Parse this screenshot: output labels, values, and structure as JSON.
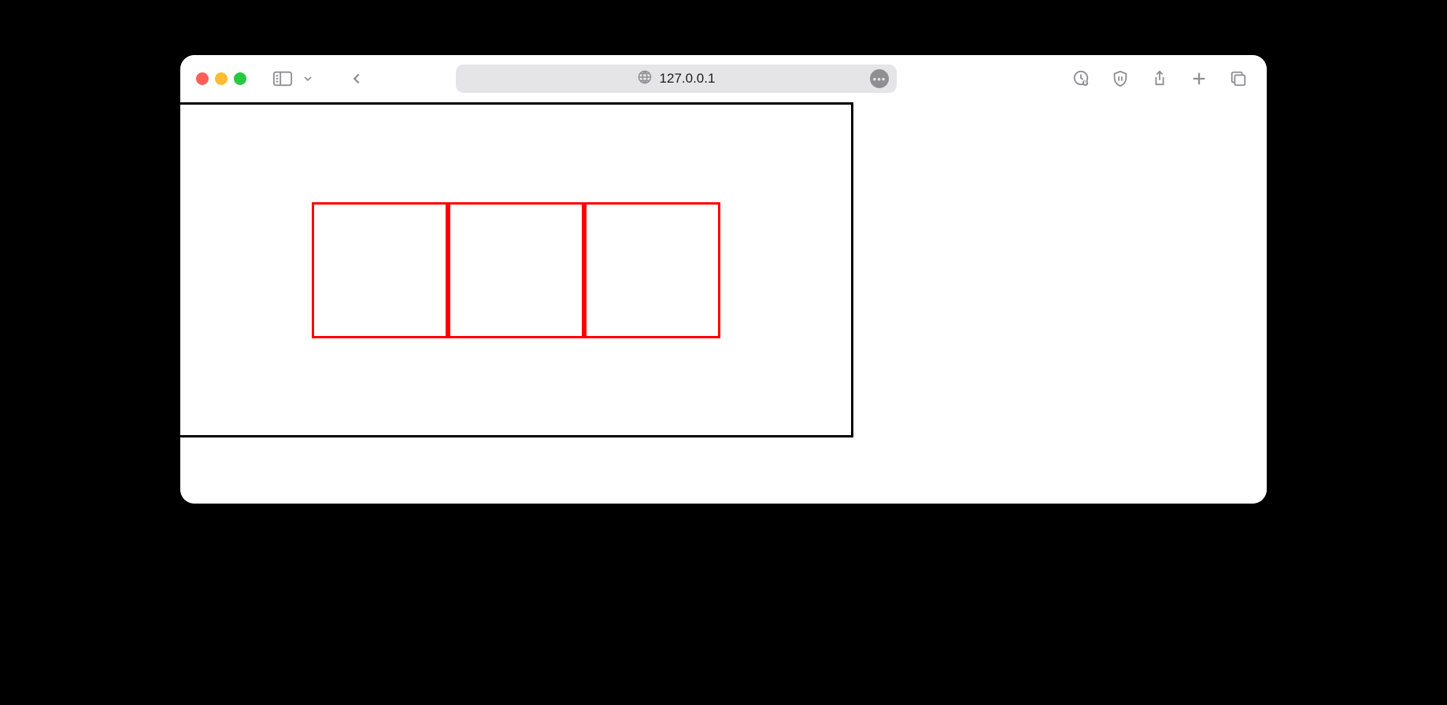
{
  "address_bar": {
    "url_display": "127.0.0.1"
  },
  "content": {
    "box_count": 3,
    "box_border_color": "#ff0000",
    "container_border_color": "#000000"
  }
}
